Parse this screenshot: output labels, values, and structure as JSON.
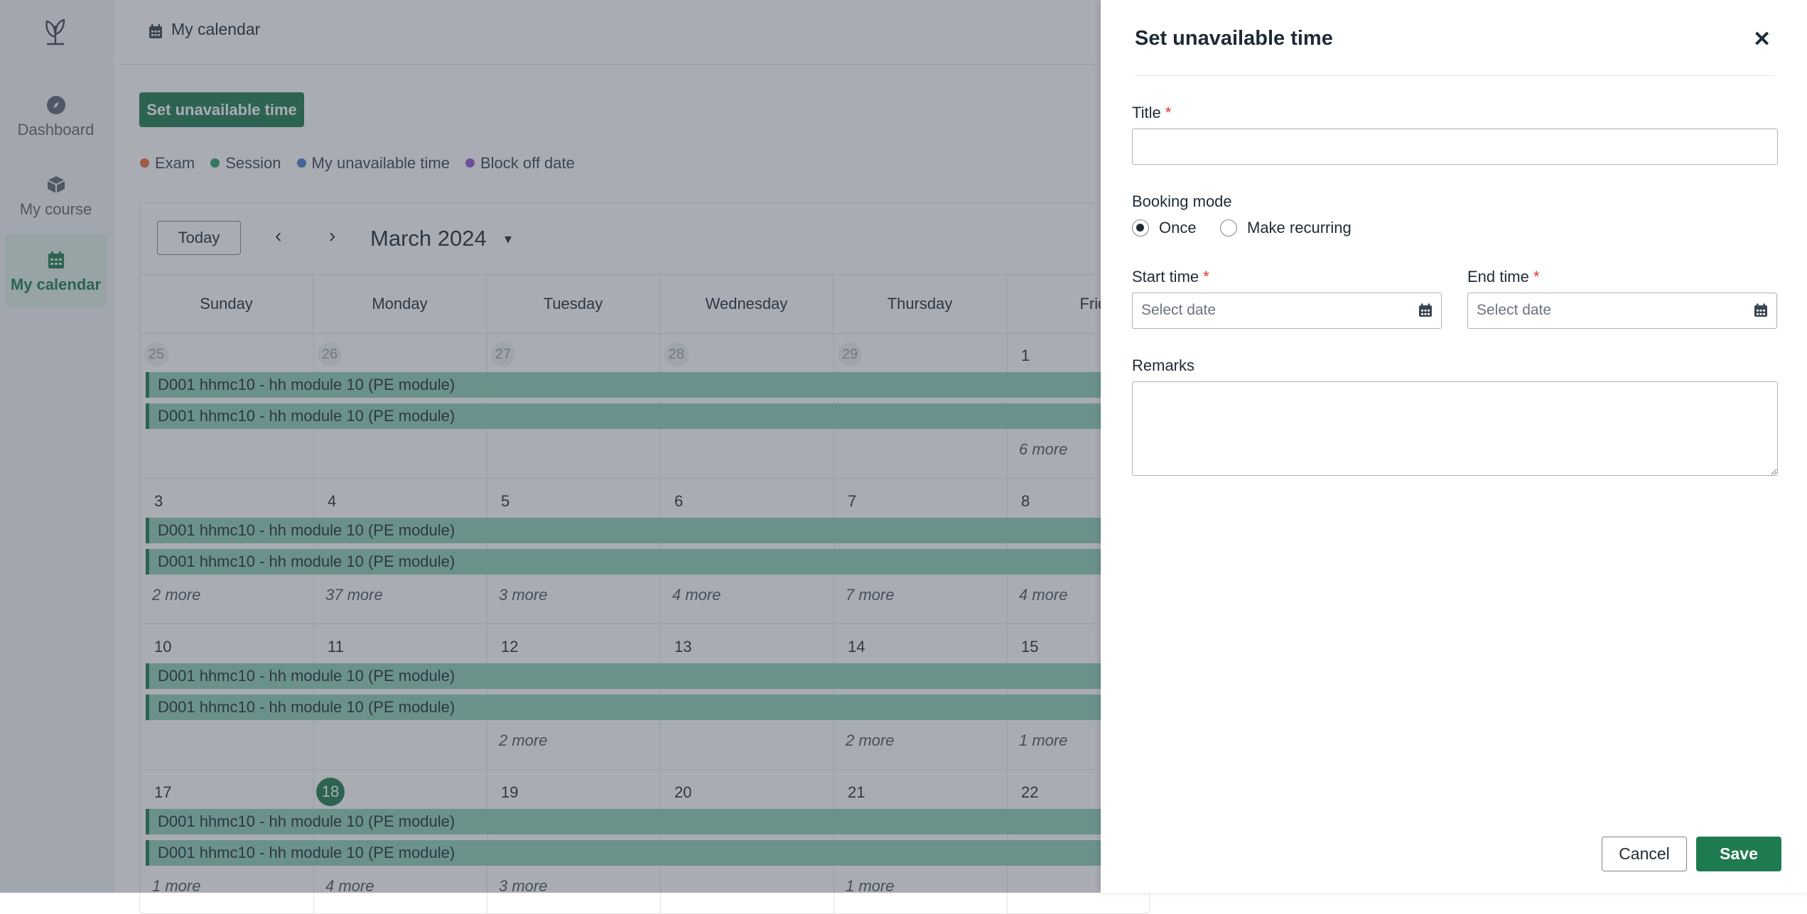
{
  "nav": {
    "items": [
      {
        "label": "Dashboard",
        "icon": "compass-icon"
      },
      {
        "label": "My course",
        "icon": "cube-icon"
      },
      {
        "label": "My calendar",
        "icon": "calendar-icon",
        "active": true
      }
    ]
  },
  "header": {
    "title": "My calendar"
  },
  "main": {
    "set_button": "Set unavailable time",
    "legend": [
      {
        "label": "Exam",
        "color": "#e8703a"
      },
      {
        "label": "Session",
        "color": "#2f9e6e"
      },
      {
        "label": "My unavailable time",
        "color": "#4a7fd4"
      },
      {
        "label": "Block off date",
        "color": "#9a55d8"
      }
    ],
    "toolbar": {
      "today": "Today",
      "prev": "‹",
      "next": "›",
      "month": "March 2024",
      "caret": "▾"
    },
    "weekdays": [
      "Sunday",
      "Monday",
      "Tuesday",
      "Wednesday",
      "Thursday",
      "Frid"
    ],
    "event_label": "D001 hhmc10 - hh module 10 (PE module)",
    "weeks": [
      {
        "days": [
          "25",
          "26",
          "27",
          "28",
          "29",
          "1"
        ],
        "prev_month": [
          true,
          true,
          true,
          true,
          true,
          false
        ],
        "more": [
          "",
          "",
          "",
          "",
          "",
          "6 more"
        ]
      },
      {
        "days": [
          "3",
          "4",
          "5",
          "6",
          "7",
          "8"
        ],
        "prev_month": [
          false,
          false,
          false,
          false,
          false,
          false
        ],
        "more": [
          "2 more",
          "37 more",
          "3 more",
          "4 more",
          "7 more",
          "4 more"
        ]
      },
      {
        "days": [
          "10",
          "11",
          "12",
          "13",
          "14",
          "15"
        ],
        "prev_month": [
          false,
          false,
          false,
          false,
          false,
          false
        ],
        "more": [
          "",
          "",
          "2 more",
          "",
          "2 more",
          "1 more"
        ]
      },
      {
        "days": [
          "17",
          "18",
          "19",
          "20",
          "21",
          "22"
        ],
        "prev_month": [
          false,
          false,
          false,
          false,
          false,
          false
        ],
        "more": [
          "1 more",
          "4 more",
          "3 more",
          "",
          "1 more",
          ""
        ],
        "today_index": 1
      }
    ]
  },
  "drawer": {
    "title": "Set unavailable time",
    "close": "✕",
    "title_label": "Title",
    "required_mark": "*",
    "booking_mode_label": "Booking mode",
    "booking_options": [
      "Once",
      "Make recurring"
    ],
    "booking_selected": "Once",
    "start_label": "Start time",
    "end_label": "End time",
    "date_placeholder": "Select date",
    "remarks_label": "Remarks",
    "cancel": "Cancel",
    "save": "Save"
  }
}
